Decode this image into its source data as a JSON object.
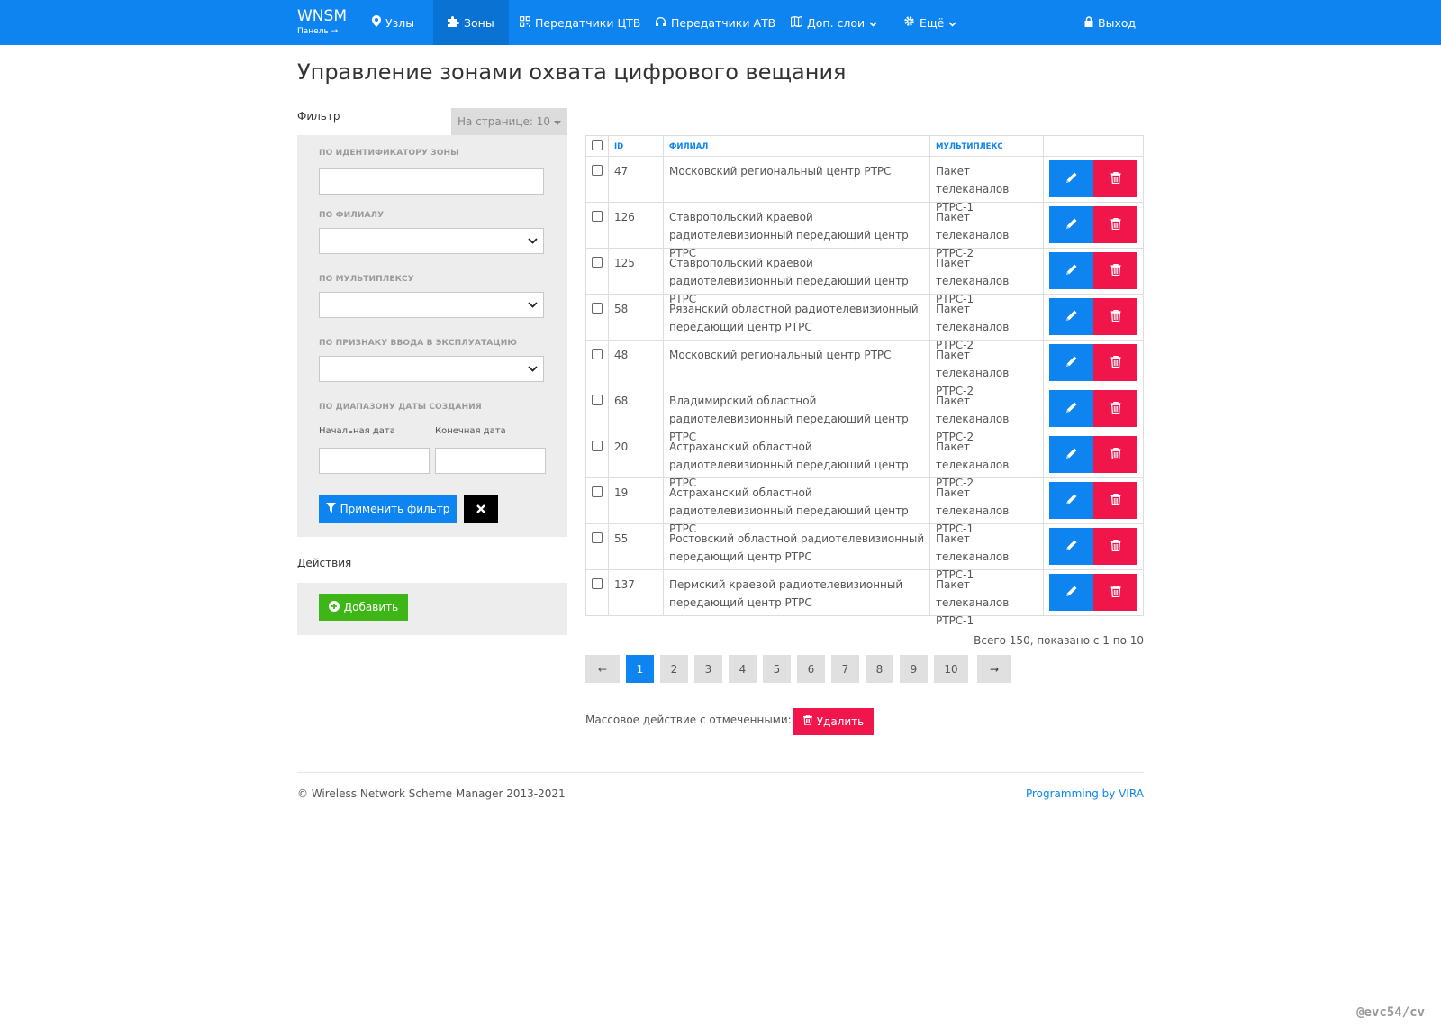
{
  "navbar": {
    "brand_title": "WNSM",
    "brand_sub": "Панель →",
    "items": [
      {
        "label": "Узлы",
        "icon": "map-marker-icon"
      },
      {
        "label": "Зоны",
        "icon": "puzzle-icon",
        "active": true
      },
      {
        "label": "Передатчики ЦТВ",
        "icon": "qrcode-icon"
      },
      {
        "label": "Передатчики АТВ",
        "icon": "headphones-icon"
      },
      {
        "label": "Доп. слои",
        "icon": "map-icon",
        "dropdown": true
      },
      {
        "label": "Ещё",
        "icon": "gear-icon",
        "dropdown": true
      }
    ],
    "logout": "Выход"
  },
  "page_title": "Управление зонами охвата цифрового вещания",
  "filter": {
    "title": "Фильтр",
    "per_page": "На странице: 10",
    "by_id_label": "по идентификатору зоны",
    "by_id_value": "",
    "by_branch_label": "по филиалу",
    "by_branch_value": "",
    "by_mux_label": "по мультиплексу",
    "by_mux_value": "",
    "by_status_label": "по признаку ввода в эксплуатацию",
    "by_status_value": "",
    "by_date_label": "по диапазону даты создания",
    "start_date_label": "Начальная дата",
    "end_date_label": "Конечная дата",
    "apply_label": "Применить фильтр"
  },
  "actions": {
    "title": "Действия",
    "add_label": "Добавить"
  },
  "table": {
    "headers": {
      "id": "ID",
      "branch": "Филиал",
      "mux": "Мультиплекс"
    },
    "rows": [
      {
        "id": "47",
        "branch": "Московский региональный центр РТРС",
        "mux": "Пакет телеканалов РТРС-1"
      },
      {
        "id": "126",
        "branch": "Ставропольский краевой радиотелевизионный передающий центр РТРС",
        "mux": "Пакет телеканалов РТРС-2"
      },
      {
        "id": "125",
        "branch": "Ставропольский краевой радиотелевизионный передающий центр РТРС",
        "mux": "Пакет телеканалов РТРС-1"
      },
      {
        "id": "58",
        "branch": "Рязанский областной радиотелевизионный передающий центр РТРС",
        "mux": "Пакет телеканалов РТРС-2"
      },
      {
        "id": "48",
        "branch": "Московский региональный центр РТРС",
        "mux": "Пакет телеканалов РТРС-2"
      },
      {
        "id": "68",
        "branch": "Владимирский областной радиотелевизионный передающий центр РТРС",
        "mux": "Пакет телеканалов РТРС-2"
      },
      {
        "id": "20",
        "branch": "Астраханский областной радиотелевизионный передающий центр РТРС",
        "mux": "Пакет телеканалов РТРС-2"
      },
      {
        "id": "19",
        "branch": "Астраханский областной радиотелевизионный передающий центр РТРС",
        "mux": "Пакет телеканалов РТРС-1"
      },
      {
        "id": "55",
        "branch": "Ростовский областной радиотелевизионный передающий центр РТРС",
        "mux": "Пакет телеканалов РТРС-1"
      },
      {
        "id": "137",
        "branch": "Пермский краевой радиотелевизионный передающий центр РТРС",
        "mux": "Пакет телеканалов РТРС-1"
      }
    ]
  },
  "summary": "Всего 150, показано с 1 по 10",
  "pagination": {
    "prev": "←",
    "next": "→",
    "pages": [
      "1",
      "2",
      "3",
      "4",
      "5",
      "6",
      "7",
      "8",
      "9",
      "10"
    ],
    "current": "1"
  },
  "bulk": {
    "label": "Массовое действие с отмеченными:",
    "delete_label": "Удалить"
  },
  "footer": {
    "copyright": "© Wireless Network Scheme Manager 2013-2021",
    "credit": "Programming by VIRA"
  },
  "watermark": "@evc54/cv",
  "colors": {
    "primary": "#0d84f0",
    "danger": "#f0154b",
    "success": "#3fb618",
    "panel": "#ededed"
  }
}
